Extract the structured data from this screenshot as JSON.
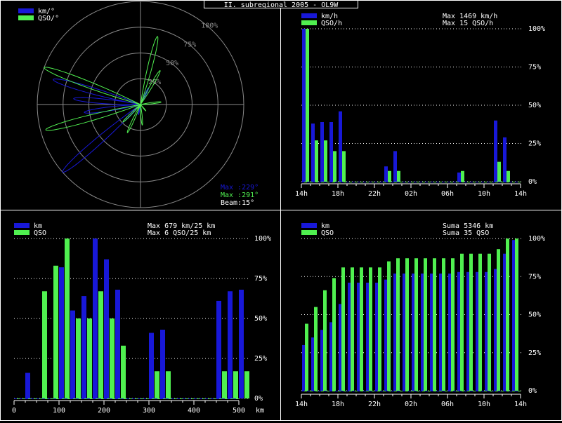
{
  "title": "II. subregional 2005 - OL9W",
  "colors": {
    "km": "#1818d8",
    "qso": "#50f050",
    "grid": "#ffffff",
    "polar_grid": "#8a8a8a",
    "axis_text": "#ffffff"
  },
  "chart_data": [
    {
      "type": "polar",
      "name": "beam",
      "legend": [
        "km/°",
        "QSO/°"
      ],
      "ring_labels": [
        "25%",
        "50%",
        "75%",
        "100%"
      ],
      "info": [
        "Max :229°",
        "Max :291°",
        "Beam:15°"
      ],
      "km_lobes": [
        {
          "deg": 229,
          "pct": 100
        },
        {
          "deg": 262,
          "pct": 55
        },
        {
          "deg": 286,
          "pct": 88
        },
        {
          "deg": 275,
          "pct": 65
        },
        {
          "deg": 26,
          "pct": 18
        },
        {
          "deg": 192,
          "pct": 10
        }
      ],
      "qso_lobes": [
        {
          "deg": 291,
          "pct": 100
        },
        {
          "deg": 255,
          "pct": 95
        },
        {
          "deg": 14,
          "pct": 68
        },
        {
          "deg": 30,
          "pct": 38
        },
        {
          "deg": 83,
          "pct": 20
        },
        {
          "deg": 205,
          "pct": 30
        },
        {
          "deg": 225,
          "pct": 24
        },
        {
          "deg": 175,
          "pct": 20
        },
        {
          "deg": 140,
          "pct": 8
        }
      ]
    },
    {
      "type": "bar",
      "name": "per-hour",
      "legend": [
        "km/h",
        "QSO/h"
      ],
      "max_lines": [
        "Max  1469 km/h",
        "Max   15 QSO/h"
      ],
      "categories": [
        "14h",
        "15h",
        "16h",
        "17h",
        "18h",
        "19h",
        "20h",
        "21h",
        "22h",
        "23h",
        "00h",
        "01h",
        "02h",
        "03h",
        "04h",
        "05h",
        "06h",
        "07h",
        "08h",
        "09h",
        "10h",
        "11h",
        "12h",
        "13h"
      ],
      "x_tick_labels": [
        "14h",
        "18h",
        "22h",
        "02h",
        "06h",
        "10h",
        "14h"
      ],
      "y_tick_labels": [
        "0%",
        "25%",
        "50%",
        "75%",
        "100%"
      ],
      "ylim": [
        0,
        100
      ],
      "series": [
        {
          "name": "km/h",
          "values": [
            100,
            38,
            39,
            39,
            46,
            0,
            0,
            0,
            0,
            10,
            20,
            0,
            0,
            0,
            0,
            0,
            0,
            6,
            0,
            0,
            0,
            40,
            29,
            0
          ]
        },
        {
          "name": "QSO/h",
          "values": [
            100,
            27,
            27,
            20,
            20,
            0,
            0,
            0,
            0,
            7,
            7,
            0,
            0,
            0,
            0,
            0,
            0,
            7,
            0,
            0,
            0,
            13,
            7,
            0
          ]
        }
      ]
    },
    {
      "type": "bar",
      "name": "per-distance",
      "legend": [
        "km",
        "QSO"
      ],
      "max_lines": [
        "Max   679 km/25 km",
        "Max    6 QSO/25 km"
      ],
      "categories": [
        0,
        25,
        50,
        75,
        100,
        125,
        150,
        175,
        200,
        225,
        250,
        275,
        300,
        325,
        350,
        375,
        400,
        425,
        450,
        475
      ],
      "x_tick_labels": [
        "0",
        "100",
        "200",
        "300",
        "400",
        "500"
      ],
      "x_unit": "km",
      "xlim": [
        0,
        500
      ],
      "y_tick_labels": [
        "0%",
        "25%",
        "50%",
        "75%",
        "100%"
      ],
      "ylim": [
        0,
        100
      ],
      "series": [
        {
          "name": "km",
          "values": [
            16,
            0,
            0,
            82,
            55,
            64,
            100,
            87,
            68,
            0,
            0,
            41,
            43,
            0,
            0,
            0,
            0,
            61,
            67,
            68
          ]
        },
        {
          "name": "QSO",
          "values": [
            0,
            67,
            83,
            100,
            50,
            50,
            67,
            50,
            33,
            0,
            0,
            17,
            17,
            0,
            0,
            0,
            0,
            17,
            17,
            17
          ]
        }
      ]
    },
    {
      "type": "bar",
      "name": "cumulative",
      "legend": [
        "km",
        "QSO"
      ],
      "max_lines": [
        "Suma   5346 km",
        "Suma    35 QSO"
      ],
      "categories": [
        "14h",
        "15h",
        "16h",
        "17h",
        "18h",
        "19h",
        "20h",
        "21h",
        "22h",
        "23h",
        "00h",
        "01h",
        "02h",
        "03h",
        "04h",
        "05h",
        "06h",
        "07h",
        "08h",
        "09h",
        "10h",
        "11h",
        "12h",
        "13h"
      ],
      "x_tick_labels": [
        "14h",
        "18h",
        "22h",
        "02h",
        "06h",
        "10h",
        "14h"
      ],
      "y_tick_labels": [
        "0%",
        "25%",
        "50%",
        "75%",
        "100%"
      ],
      "ylim": [
        0,
        100
      ],
      "series": [
        {
          "name": "km",
          "values": [
            30,
            35,
            40,
            45,
            57,
            71,
            71,
            71,
            71,
            73,
            77,
            77,
            77,
            77,
            77,
            77,
            77,
            78,
            78,
            78,
            78,
            80,
            90,
            99
          ]
        },
        {
          "name": "QSO",
          "values": [
            44,
            55,
            66,
            74,
            81,
            81,
            81,
            81,
            81,
            85,
            87,
            87,
            87,
            87,
            87,
            87,
            87,
            90,
            90,
            90,
            90,
            93,
            100,
            100
          ]
        }
      ]
    }
  ]
}
